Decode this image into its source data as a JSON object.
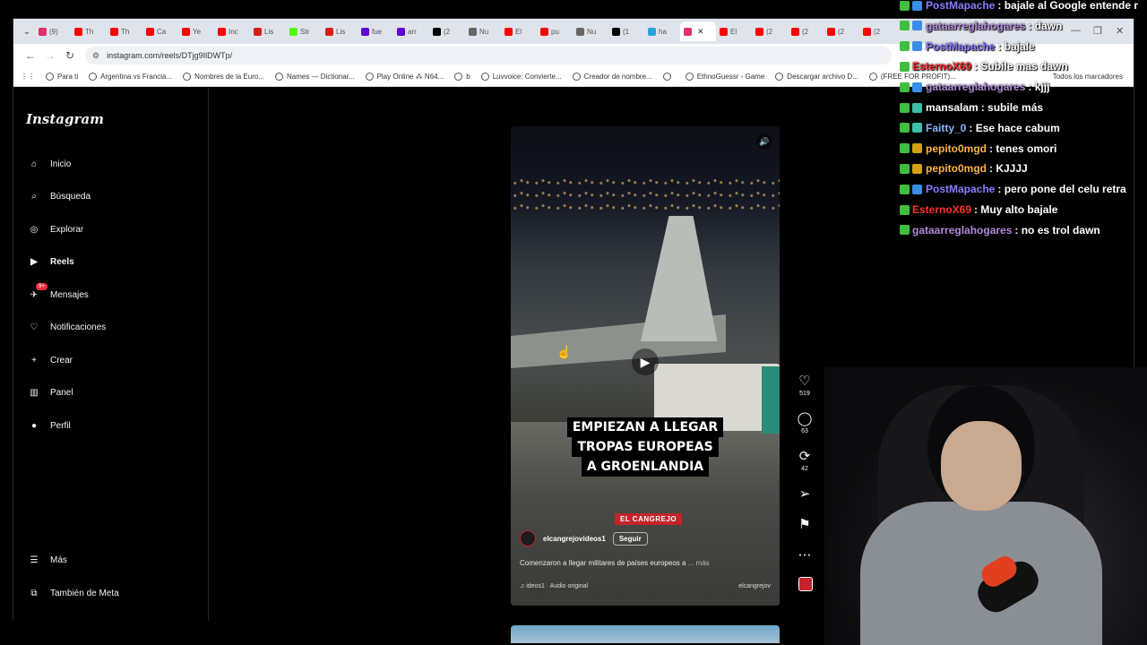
{
  "browser": {
    "tabs": [
      {
        "label": "(9)",
        "color": "#e1306c"
      },
      {
        "label": "Th",
        "color": "#ff0000"
      },
      {
        "label": "Th",
        "color": "#ff0000"
      },
      {
        "label": "Ca",
        "color": "#ff0000"
      },
      {
        "label": "Ye",
        "color": "#ff0000"
      },
      {
        "label": "Inc",
        "color": "#ff0000"
      },
      {
        "label": "Lis",
        "color": "#d91e18"
      },
      {
        "label": "Str",
        "color": "#53fc18"
      },
      {
        "label": "Lis",
        "color": "#d91e18"
      },
      {
        "label": "fue",
        "color": "#6001d2"
      },
      {
        "label": "arr",
        "color": "#6001d2"
      },
      {
        "label": "(2",
        "color": "#000000"
      },
      {
        "label": "Nu",
        "color": "#666666"
      },
      {
        "label": "El",
        "color": "#ff0000"
      },
      {
        "label": "pu",
        "color": "#ff0000"
      },
      {
        "label": "Nu",
        "color": "#666666"
      },
      {
        "label": "(1",
        "color": "#000000"
      },
      {
        "label": "ha",
        "color": "#2aa3de"
      },
      {
        "label": "",
        "color": "#e1306c",
        "active": true
      },
      {
        "label": "El",
        "color": "#ff0000"
      },
      {
        "label": "(2",
        "color": "#ff0000"
      },
      {
        "label": "(2",
        "color": "#ff0000"
      },
      {
        "label": "(2",
        "color": "#ff0000"
      },
      {
        "label": "(2",
        "color": "#ff0000"
      }
    ],
    "url": "instagram.com/reels/DTjg9IlDWTp/",
    "bookmarks": [
      "Para ti",
      "Argentina vs Francia...",
      "Nombres de la Euro...",
      "Names — Dictionar...",
      "Play Online ⁂ N64...",
      "b",
      "Luvvoice: Convierte...",
      "Creador de nombre...",
      "",
      "EthnoGuessr - Game",
      "Descargar archivo D...",
      "(FREE FOR PROFIT)..."
    ],
    "all_bookmarks": "Todos los marcadores"
  },
  "instagram": {
    "logo": "Instagram",
    "nav": [
      {
        "label": "Inicio",
        "icon": "home-icon"
      },
      {
        "label": "Búsqueda",
        "icon": "search-icon"
      },
      {
        "label": "Explorar",
        "icon": "compass-icon"
      },
      {
        "label": "Reels",
        "icon": "reels-icon",
        "active": true
      },
      {
        "label": "Mensajes",
        "icon": "messenger-icon",
        "badge": "9+"
      },
      {
        "label": "Notificaciones",
        "icon": "heart-icon"
      },
      {
        "label": "Crear",
        "icon": "plus-icon"
      },
      {
        "label": "Panel",
        "icon": "chart-icon"
      },
      {
        "label": "Perfil",
        "icon": "avatar-icon"
      }
    ],
    "more": "Más",
    "meta": "También de Meta",
    "reel": {
      "caption_lines": [
        "EMPIEZAN A LLEGAR",
        "TROPAS EUROPEAS",
        "A GROENLANDIA"
      ],
      "brand_tag": "EL CANGREJO",
      "author": "elcangrejovideos1",
      "follow": "Seguir",
      "description": "Comenzaron a llegar militares de países europeos a",
      "description_more": "... más",
      "audio": "ideos1 · Audio original",
      "audio_author": "elcangrejov",
      "likes": "519",
      "comments": "63",
      "reposts": "42"
    }
  },
  "chat": [
    {
      "user": "PostMapache",
      "color": "#8a7cff",
      "badge": "#3a8ee6",
      "msg": ": bajale al Google entende r"
    },
    {
      "user": "gataarreglahogares",
      "color": "#b18ad9",
      "badge": "#3a8ee6",
      "msg": ": dawn"
    },
    {
      "user": "PostMapache",
      "color": "#8a7cff",
      "badge": "#3a8ee6",
      "msg": ": bajale"
    },
    {
      "user": "EsternoX69",
      "color": "#ff3030",
      "badge": "",
      "msg": ": Subile mas dawn"
    },
    {
      "user": "gataarreglahogares",
      "color": "#b18ad9",
      "badge": "#3a8ee6",
      "msg": ": kjjj"
    },
    {
      "user": "mansalam",
      "color": "#ffffff",
      "badge": "#3fbfa8",
      "msg": ": subile más"
    },
    {
      "user": "Faitty_0",
      "color": "#8ab4ff",
      "badge": "#3fbfa8",
      "msg": ": Ese hace cabum"
    },
    {
      "user": "pepito0mgd",
      "color": "#ffb347",
      "badge": "#d4a017",
      "msg": ": tenes omori"
    },
    {
      "user": "pepito0mgd",
      "color": "#ffb347",
      "badge": "#d4a017",
      "msg": ": KJJJJ"
    },
    {
      "user": "PostMapache",
      "color": "#8a7cff",
      "badge": "#3a8ee6",
      "msg": ": pero pone del celu retra"
    },
    {
      "user": "EsternoX69",
      "color": "#ff3030",
      "badge": "",
      "msg": ": Muy alto bajale"
    },
    {
      "user": "gataarreglahogares",
      "color": "#b18ad9",
      "badge": "",
      "msg": ": no es trol dawn"
    }
  ]
}
